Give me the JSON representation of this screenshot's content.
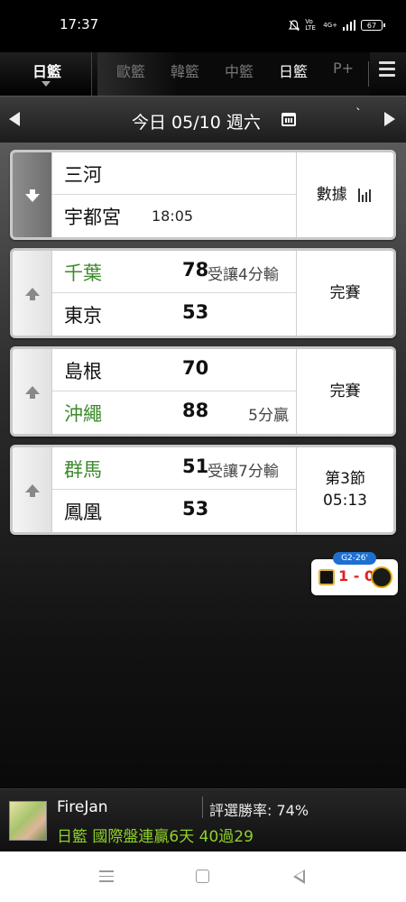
{
  "status_bar": {
    "time": "17:37",
    "icons": [
      "mute-icon",
      "volte-icon",
      "4g-signal-icon",
      "signal-icon"
    ],
    "volte_text": "Vo LTE",
    "network_text": "4G+",
    "battery": "67"
  },
  "tabs": {
    "active": "日籃",
    "items": [
      "歐籃",
      "韓籃",
      "中籃",
      "日籃",
      "P+"
    ],
    "highlighted_index": 3
  },
  "date_bar": {
    "label": "今日 05/10 週六",
    "extra_mark": "`"
  },
  "games": [
    {
      "team1": "三河",
      "team2": "宇都宮",
      "score1": "",
      "score2": "",
      "note1": "",
      "note2": "",
      "kickoff": "18:05",
      "status": "數據",
      "winner": "",
      "focused": true
    },
    {
      "team1": "千葉",
      "team2": "東京",
      "score1": "78",
      "score2": "53",
      "note1": "受讓4分輸",
      "note2": "",
      "kickoff": "",
      "status": "完賽",
      "winner": "team1",
      "focused": false
    },
    {
      "team1": "島根",
      "team2": "沖繩",
      "score1": "70",
      "score2": "88",
      "note1": "",
      "note2": "5分贏",
      "kickoff": "",
      "status": "完賽",
      "winner": "team2",
      "focused": false
    },
    {
      "team1": "群馬",
      "team2": "鳳凰",
      "score1": "51",
      "score2": "53",
      "note1": "受讓7分輸",
      "note2": "",
      "kickoff": "",
      "status_line1": "第3節",
      "status_line2": "05:13",
      "winner": "team1",
      "focused": false
    }
  ],
  "promo": {
    "badge": "G2-26'",
    "score": "1 - 0"
  },
  "user": {
    "name": "FireJan",
    "rate_label": "評選勝率: 74%",
    "record": "日籃 國際盤連贏6天 40過29"
  },
  "colors": {
    "win_green": "#3a8a2a",
    "record_green": "#8fd12a",
    "promo_blue": "#1f6fd0",
    "promo_red": "#dd2222"
  }
}
